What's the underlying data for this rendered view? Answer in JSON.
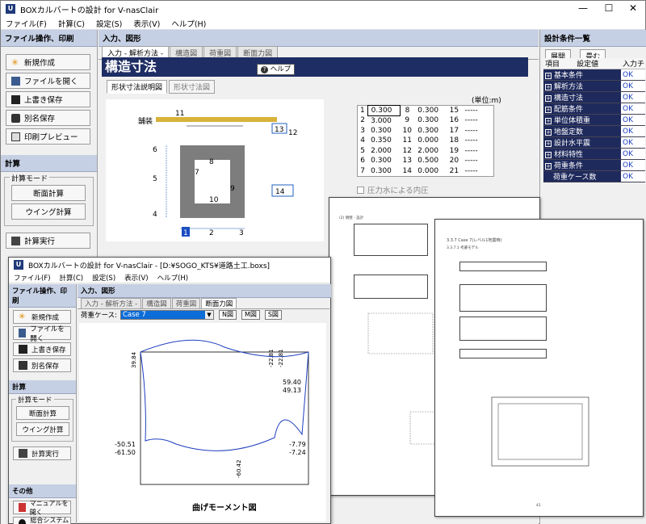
{
  "main_window": {
    "title": "BOXカルバートの設計 for V-nasClair",
    "menu": [
      "ファイル(F)",
      "計算(C)",
      "設定(S)",
      "表示(V)",
      "ヘルプ(H)"
    ],
    "controls": {
      "minimize": "—",
      "maximize": "☐",
      "close": "✕"
    }
  },
  "left_panel": {
    "file_header": "ファイル操作、印刷",
    "file_buttons": [
      "新規作成",
      "ファイルを開く",
      "上書き保存",
      "別名保存",
      "印刷プレビュー"
    ],
    "calc_header": "計算",
    "calc_mode_label": "計算モード",
    "calc_mode_buttons": [
      "断面計算",
      "ウイング計算"
    ],
    "run_button": "計算実行"
  },
  "center_panel": {
    "header": "入力、図形",
    "tabs": [
      "入力 - 解析方法 -",
      "構造図",
      "荷重図",
      "断面力図"
    ],
    "section_title": "構造寸法",
    "help_label": "ヘルプ",
    "subtabs": [
      "形状寸法説明図",
      "形状寸法図"
    ],
    "unit_label": "(単位:m)",
    "pressure_checkbox": "圧力水による内圧",
    "diagram_label": "舗装",
    "diagram_numbers": [
      "11",
      "13",
      "12",
      "6",
      "8",
      "7",
      "5",
      "10",
      "9",
      "14",
      "4",
      "1",
      "2",
      "3"
    ]
  },
  "dimension_table": [
    {
      "n1": "1",
      "v1": "0.300",
      "n2": "8",
      "v2": "0.300",
      "n3": "15",
      "v3": "-----"
    },
    {
      "n1": "2",
      "v1": "3.000",
      "n2": "9",
      "v2": "0.300",
      "n3": "16",
      "v3": "-----"
    },
    {
      "n1": "3",
      "v1": "0.300",
      "n2": "10",
      "v2": "0.300",
      "n3": "17",
      "v3": "-----"
    },
    {
      "n1": "4",
      "v1": "0.350",
      "n2": "11",
      "v2": "0.000",
      "n3": "18",
      "v3": "-----"
    },
    {
      "n1": "5",
      "v1": "2.000",
      "n2": "12",
      "v2": "2.000",
      "n3": "19",
      "v3": "-----"
    },
    {
      "n1": "6",
      "v1": "0.300",
      "n2": "13",
      "v2": "0.500",
      "n3": "20",
      "v3": "-----"
    },
    {
      "n1": "7",
      "v1": "0.300",
      "n2": "14",
      "v2": "0.000",
      "n3": "21",
      "v3": "-----"
    }
  ],
  "right_panel": {
    "header": "設計条件一覧",
    "expand_label": "展開",
    "collapse_label": "畳む",
    "columns": [
      "項目",
      "設定値",
      "入力チ"
    ],
    "rows": [
      {
        "item": "基本条件",
        "status": "OK"
      },
      {
        "item": "解析方法",
        "status": "OK"
      },
      {
        "item": "構造寸法",
        "status": "OK"
      },
      {
        "item": "配筋条件",
        "status": "OK"
      },
      {
        "item": "単位体積重",
        "status": "OK"
      },
      {
        "item": "地盤定数",
        "status": "OK"
      },
      {
        "item": "設計水平震",
        "status": "OK"
      },
      {
        "item": "材料特性",
        "status": "OK"
      },
      {
        "item": "荷重条件",
        "status": "OK"
      },
      {
        "item": "荷重ケース数",
        "status": "OK"
      }
    ]
  },
  "second_window": {
    "title": "BOXカルバートの設計 for V-nasClair - [D:¥SOGO_KTS¥道路土工.boxs]",
    "menu": [
      "ファイル(F)",
      "計算(C)",
      "設定(S)",
      "表示(V)",
      "ヘルプ(H)"
    ],
    "file_header": "ファイル操作、印刷",
    "file_buttons": [
      "新規作成",
      "ファイルを開く",
      "上書き保存",
      "別名保存"
    ],
    "calc_header": "計算",
    "calc_mode_label": "計算モード",
    "calc_mode_buttons": [
      "断面計算",
      "ウイング計算"
    ],
    "run_button": "計算実行",
    "other_header": "その他",
    "other_buttons": [
      "マニュアルを開く",
      "総合システムHP"
    ],
    "center_header": "入力、図形",
    "tabs": [
      "入力 - 解析方法 -",
      "構造図",
      "荷重図",
      "断面力図"
    ],
    "load_case_label": "荷重ケース:",
    "load_case_value": "Case 7",
    "nms_buttons": [
      "N図",
      "M図",
      "S図"
    ],
    "chart_title": "曲げモーメント図",
    "moment_values": [
      "59.40",
      "49.13",
      "-50.51",
      "-61.50",
      "-7.79",
      "-7.24",
      "39.84",
      "-22.81",
      "-22.81",
      "-60.42"
    ]
  },
  "printed_pages": {
    "page_a_heading": "(2) 側壁 - 設計",
    "page_b_heading": "3.3.7 Case 7(レベル1地震時)",
    "page_b_sub": "3.3.7.1 考慮モデル",
    "page_b_number": "41"
  }
}
